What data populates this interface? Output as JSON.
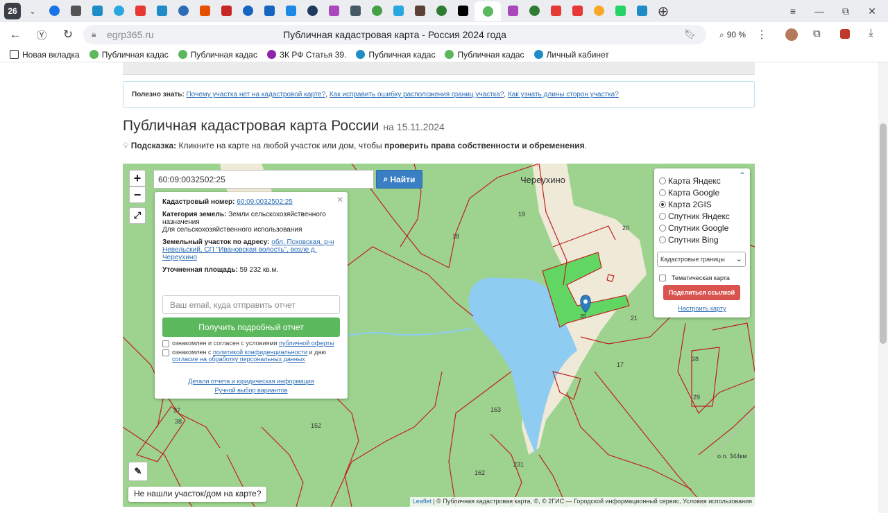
{
  "browser": {
    "tab_counter": "26",
    "url_domain": "egrp365.ru",
    "page_title": "Публичная кадастровая карта - Россия 2024 года",
    "zoom": "90 %",
    "tab_icon_colors": [
      "#1a73e8",
      "#555",
      "#1f8cc8",
      "#29a7e1",
      "#e53935",
      "#1f8cc8",
      "#2a6db5",
      "#e65100",
      "#c62828",
      "#1565c0",
      "#1565c0",
      "#1e88e5",
      "#1e3a5f",
      "#ab47bc",
      "#455a64",
      "#43a047",
      "#29a7e1",
      "#5d4037",
      "#2e7d32",
      "#000",
      "#ab47bc",
      "#2e7d32",
      "#e53935",
      "#e53935",
      "#f9a825",
      "#25d366",
      "#1f8cc8"
    ],
    "bookmarks": [
      {
        "label": "Новая вкладка",
        "color": "#333",
        "icon": "tab-icon"
      },
      {
        "label": "Публичная кадас",
        "color": "#5cb85c",
        "icon": "check-icon"
      },
      {
        "label": "Публичная кадас",
        "color": "#5cb85c",
        "icon": "check-icon"
      },
      {
        "label": "ЗК РФ Статья 39.",
        "color": "#8e24aa",
        "icon": "law-icon"
      },
      {
        "label": "Публичная кадас",
        "color": "#1f8cc8",
        "icon": "map-icon"
      },
      {
        "label": "Публичная кадас",
        "color": "#5cb85c",
        "icon": "check-icon"
      },
      {
        "label": "Личный кабинет",
        "color": "#1f8cc8",
        "icon": "cabinet-icon"
      }
    ]
  },
  "page": {
    "useful_label": "Полезно знать:",
    "useful_links": [
      "Почему участка нет на кадастровой карте?",
      "Как исправить ошибку расположения границ участка?",
      "Как узнать длины сторон участка?"
    ],
    "heading": "Публичная кадастровая карта России",
    "heading_date": "на 15.11.2024",
    "hint_label": "Подсказка:",
    "hint_text": "Кликните на карте на любой участок или дом, чтобы",
    "hint_bold": "проверить права собственности и обременения",
    "hint_end": "."
  },
  "map": {
    "zoom_in": "+",
    "zoom_out": "−",
    "search_value": "60:09:0032502:25",
    "search_button": "Найти",
    "village_label": "Череухино",
    "not_found": "Не нашли участок/дом на карте?",
    "attribution_leaflet": "Leaflet",
    "attribution_rest": "| © Публичная кадастровая карта, ©, © 2ГИС — Городской информационный сервис, Условия использования",
    "labels": [
      "19",
      "18",
      "20",
      "21",
      "25",
      "17",
      "28",
      "29",
      "163",
      "152",
      "231",
      "162",
      "37",
      "38",
      "о.п. 344км"
    ],
    "colors": {
      "land": "#9dd38f",
      "water": "#8fccf2",
      "sand": "#efe9d7",
      "border": "#c02020",
      "selected": "#62d662",
      "marker": "#2f7dc0"
    }
  },
  "popup": {
    "cad_label": "Кадастровый номер:",
    "cad_value": "60:09:0032502:25",
    "category_label": "Категория земель:",
    "category_value": "Земли сельскохозяйственного назначения",
    "usage": "Для сельскохозяйственного использования",
    "address_label": "Земельный участок по адресу:",
    "address_value": "обл. Псковская, р-н Невельский, СП \"Ивановская волость\", возле д. Череухино",
    "area_label": "Уточненная площадь:",
    "area_value": "59 232 кв.м.",
    "email_placeholder": "Ваш email, куда отправить отчет",
    "report_button": "Получить подробный отчет",
    "agree1_text": "ознакомлен и согласен с условиями",
    "agree1_link": "публичной оферты",
    "agree2_text": "ознакомлен с",
    "agree2_link": "политикой конфиденциальности",
    "agree2_mid": "и даю",
    "agree2_link2": "согласие на обработку персональных данных",
    "details_link": "Детали отчета и юридическая информация",
    "manual_link": "Ручной выбор вариантов"
  },
  "layers": {
    "options": [
      {
        "label": "Карта Яндекс",
        "selected": false
      },
      {
        "label": "Карта Google",
        "selected": false
      },
      {
        "label": "Карта 2GIS",
        "selected": true
      },
      {
        "label": "Спутник Яндекс",
        "selected": false
      },
      {
        "label": "Спутник Google",
        "selected": false
      },
      {
        "label": "Спутник Bing",
        "selected": false
      }
    ],
    "select_value": "Кадастровые границы",
    "thematic": "Тематическая карта",
    "share_button": "Поделиться ссылкой",
    "tune_link": "Настроить карту"
  }
}
